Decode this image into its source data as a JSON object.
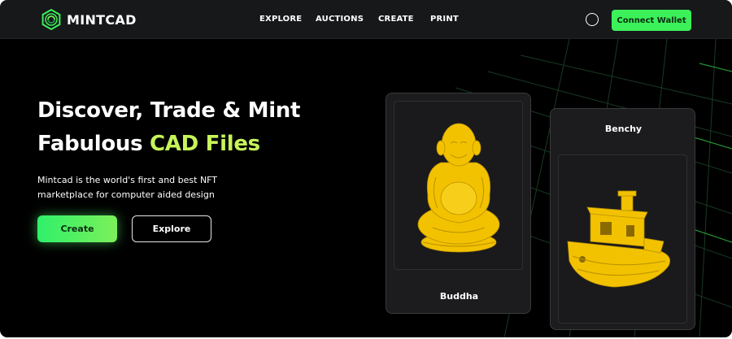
{
  "header": {
    "brand": "MINTCAD",
    "nav": [
      {
        "label": "EXPLORE"
      },
      {
        "label": "AUCTIONS"
      },
      {
        "label": "CREATE"
      },
      {
        "label": "PRINT"
      }
    ],
    "theme_toggle_icon": "circle-icon",
    "connect_wallet_label": "Connect Wallet"
  },
  "hero": {
    "title_line1": "Discover, Trade & Mint",
    "title_line2_prefix": "Fabulous ",
    "title_line2_accent": "CAD Files",
    "subtitle_line1": "Mintcad is the world's first and best NFT",
    "subtitle_line2": "marketplace for computer aided design",
    "create_label": "Create",
    "explore_label": "Explore"
  },
  "cards": [
    {
      "label": "Buddha",
      "model_icon": "buddha-model"
    },
    {
      "label": "Benchy",
      "model_icon": "benchy-boat-model"
    }
  ],
  "colors": {
    "background": "#000000",
    "header_bg": "#16181a",
    "accent_green": "#3cf05a",
    "accent_lime": "#c6f45a",
    "model_yellow": "#f2c200",
    "card_bg": "#1c1c1e"
  }
}
